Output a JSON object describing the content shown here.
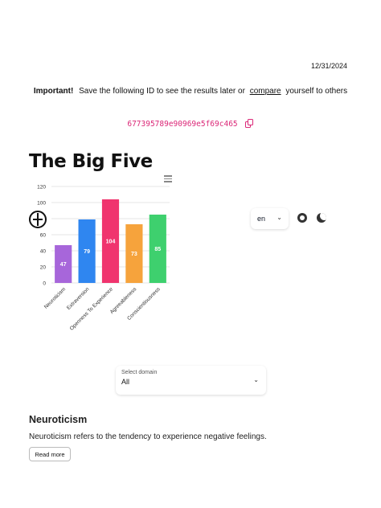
{
  "header": {
    "date": "12/31/2024",
    "important_label": "Important!",
    "important_text_before": "Save the following ID to see the results later or",
    "compare_link": "compare",
    "important_text_after": "yourself to others",
    "result_id": "677395789e90969e5f69c465",
    "copy_icon": "copy-icon"
  },
  "title": "The Big Five",
  "navbar": {
    "logo_icon": "brain-icon",
    "language": "en",
    "github_icon": "github-icon",
    "theme_icon": "moon-icon"
  },
  "chart_data": {
    "type": "bar",
    "categories": [
      "Neuroticism",
      "Extraversion",
      "Openness To Experience",
      "Agreeableness",
      "Conscientiousness"
    ],
    "values": [
      47,
      79,
      104,
      73,
      85
    ],
    "colors": [
      "#a766da",
      "#2f86f0",
      "#f0346e",
      "#f6a33c",
      "#3ed06e"
    ],
    "yticks": [
      0,
      20,
      40,
      60,
      80,
      100,
      120
    ],
    "ylim": [
      0,
      120
    ],
    "grid": true,
    "menu_icon": "hamburger-menu-icon"
  },
  "domain_select": {
    "label": "Select domain",
    "value": "All"
  },
  "section": {
    "title": "Neuroticism",
    "description": "Neuroticism refers to the tendency to experience negative feelings.",
    "read_more": "Read more"
  }
}
